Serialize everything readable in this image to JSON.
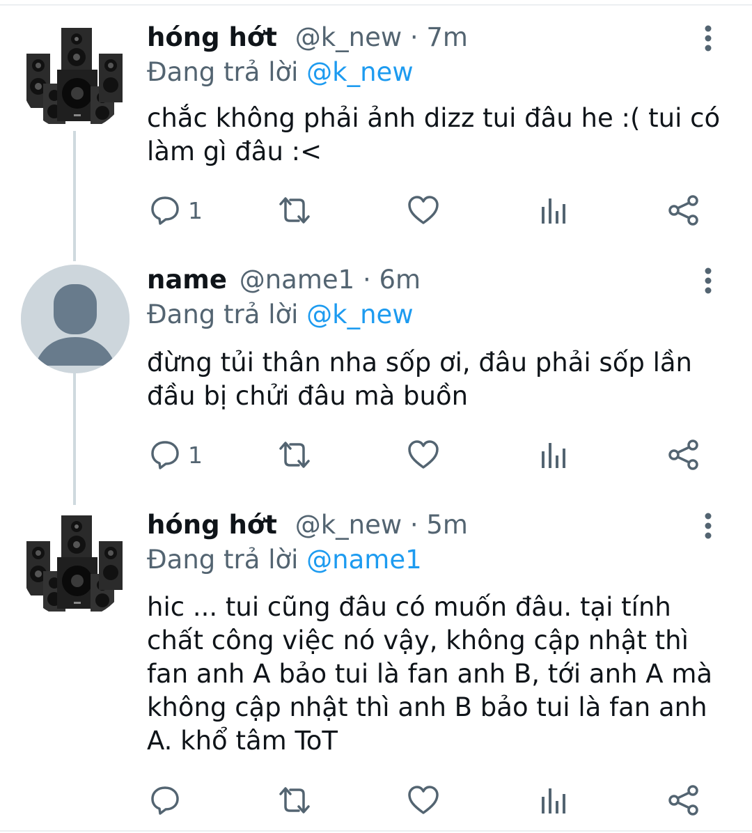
{
  "reply_prefix": "Đang trả lời",
  "tweets": [
    {
      "display_name": "hóng hớt",
      "handle": "@k_new",
      "dot": "·",
      "time": "7m",
      "reply_to": "@k_new",
      "lines": [
        "chắc không phải ảnh dizz tui đâu he :( tui có",
        "làm gì đâu :<"
      ],
      "reply_count": "1",
      "avatar": "speakers-avatar"
    },
    {
      "display_name": "name",
      "handle": "@name1",
      "dot": "·",
      "time": "6m",
      "reply_to": "@k_new",
      "lines": [
        "đừng tủi thân nha sốp ơi, đâu phải sốp lần",
        "đầu bị chửi đâu mà buồn"
      ],
      "reply_count": "1",
      "avatar": "default-avatar"
    },
    {
      "display_name": "hóng hớt",
      "handle": "@k_new",
      "dot": "·",
      "time": "5m",
      "reply_to": "@name1",
      "lines": [
        "hic ... tui cũng đâu có muốn đâu. tại tính",
        "chất công việc nó vậy, không cập nhật thì",
        "fan anh A bảo tui là fan anh B, tới anh A mà",
        "không cập nhật thì anh B bảo tui là fan anh",
        "A. khổ tâm ToT"
      ],
      "reply_count": "",
      "avatar": "speakers-avatar"
    }
  ],
  "colors": {
    "text": "#0f1419",
    "secondary": "#536471",
    "link": "#1d9bf0",
    "thread_line": "#cfd9de"
  },
  "icons": {
    "reply": "reply-icon",
    "retweet": "retweet-icon",
    "like": "heart-icon",
    "views": "views-icon",
    "share": "share-icon",
    "more": "more-vertical-icon"
  }
}
